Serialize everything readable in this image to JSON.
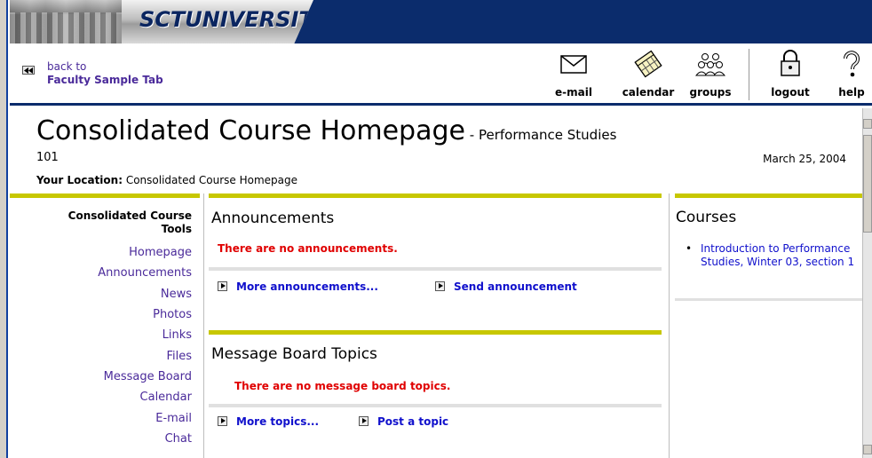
{
  "banner": {
    "logo_text": "SCTUNIVERSITY"
  },
  "toolbar": {
    "back_line1": "back to",
    "back_line2": "Faculty Sample Tab",
    "email": "e-mail",
    "calendar": "calendar",
    "groups": "groups",
    "logout": "logout",
    "help": "help"
  },
  "page": {
    "title": "Consolidated Course Homepage",
    "subtitle": " - Performance Studies",
    "course_code": "101",
    "date": "March 25, 2004",
    "location_label": "Your Location:",
    "location_value": " Consolidated Course Homepage"
  },
  "tools": {
    "heading_line1": "Consolidated Course",
    "heading_line2": "Tools",
    "items": [
      "Homepage",
      "Announcements",
      "News",
      "Photos",
      "Links",
      "Files",
      "Message Board",
      "Calendar",
      "E-mail",
      "Chat"
    ]
  },
  "announcements": {
    "title": "Announcements",
    "empty": "There are no announcements.",
    "more": "More announcements...",
    "send": "Send announcement"
  },
  "message_board": {
    "title": "Message Board Topics",
    "empty": "There are no message board topics.",
    "more": "More topics...",
    "post": "Post a topic"
  },
  "courses": {
    "title": "Courses",
    "bullet": "•",
    "item": "Introduction to Performance Studies, Winter 03, section 1"
  },
  "colors": {
    "navy": "#0b2c6c",
    "olive_bar": "#c7c700",
    "link_purple": "#4a2a9a",
    "link_blue": "#1010cc",
    "alert_red": "#e00000"
  }
}
